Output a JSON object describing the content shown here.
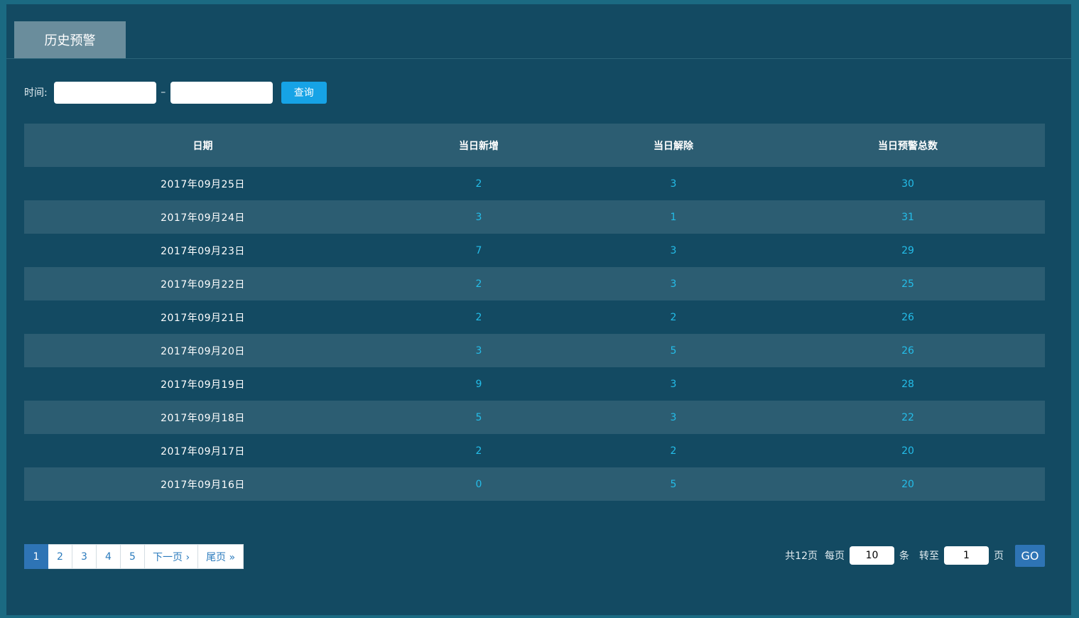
{
  "tab": {
    "label": "历史预警"
  },
  "filter": {
    "label": "时间:",
    "start_value": "",
    "end_value": "",
    "separator": "–",
    "query_label": "查询"
  },
  "table": {
    "headers": [
      "日期",
      "当日新增",
      "当日解除",
      "当日预警总数"
    ],
    "rows": [
      [
        "2017年09月25日",
        "2",
        "3",
        "30"
      ],
      [
        "2017年09月24日",
        "3",
        "1",
        "31"
      ],
      [
        "2017年09月23日",
        "7",
        "3",
        "29"
      ],
      [
        "2017年09月22日",
        "2",
        "3",
        "25"
      ],
      [
        "2017年09月21日",
        "2",
        "2",
        "26"
      ],
      [
        "2017年09月20日",
        "3",
        "5",
        "26"
      ],
      [
        "2017年09月19日",
        "9",
        "3",
        "28"
      ],
      [
        "2017年09月18日",
        "5",
        "3",
        "22"
      ],
      [
        "2017年09月17日",
        "2",
        "2",
        "20"
      ],
      [
        "2017年09月16日",
        "0",
        "5",
        "20"
      ]
    ]
  },
  "pagination": {
    "pages": [
      "1",
      "2",
      "3",
      "4",
      "5"
    ],
    "current": "1",
    "next_label": "下一页 ›",
    "last_label": "尾页 »",
    "total_text": "共12页",
    "per_page_label": "每页",
    "per_page_value": "10",
    "per_page_unit": "条",
    "goto_label": "转至",
    "goto_value": "1",
    "goto_unit": "页",
    "go_label": "GO"
  },
  "colors": {
    "background": "#134a62",
    "accent": "#16a3e6",
    "number_text": "#24bde9",
    "active_page": "#2e74b5"
  }
}
